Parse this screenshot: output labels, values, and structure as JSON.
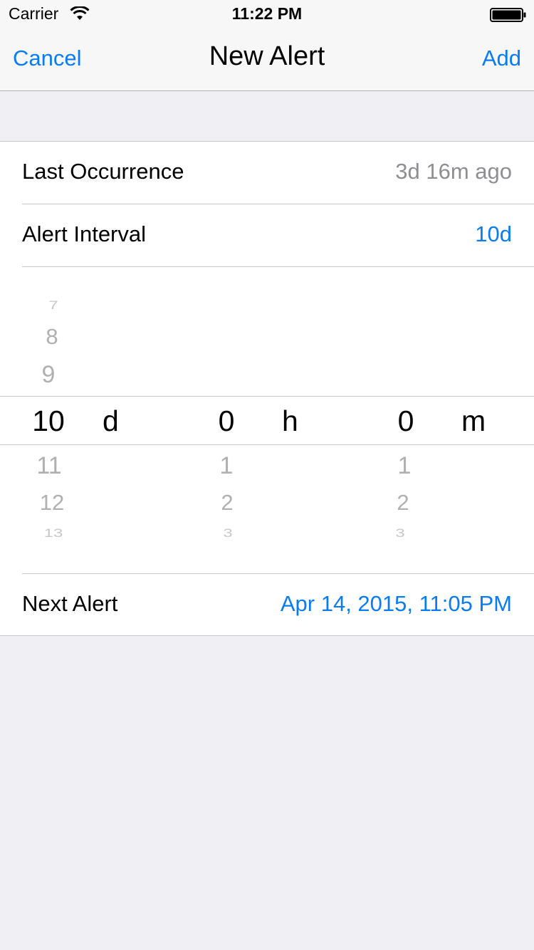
{
  "status_bar": {
    "carrier": "Carrier",
    "time": "11:22 PM"
  },
  "nav": {
    "cancel_label": "Cancel",
    "title": "New Alert",
    "add_label": "Add"
  },
  "colors": {
    "accent": "#0a7cf2",
    "secondary_text": "#8e8e93"
  },
  "rows": {
    "last_occurrence": {
      "label": "Last Occurrence",
      "value": "3d 16m ago"
    },
    "alert_interval": {
      "label": "Alert Interval",
      "value": "10d"
    },
    "next_alert": {
      "label": "Next Alert",
      "value": "Apr 14, 2015, 11:05 PM"
    }
  },
  "picker": {
    "days": {
      "unit": "d",
      "above": [
        "7",
        "8",
        "9"
      ],
      "selected": "10",
      "below": [
        "11",
        "12",
        "13"
      ]
    },
    "hours": {
      "unit": "h",
      "selected": "0",
      "below": [
        "1",
        "2",
        "3"
      ]
    },
    "minutes": {
      "unit": "m",
      "selected": "0",
      "below": [
        "1",
        "2",
        "3"
      ]
    }
  }
}
